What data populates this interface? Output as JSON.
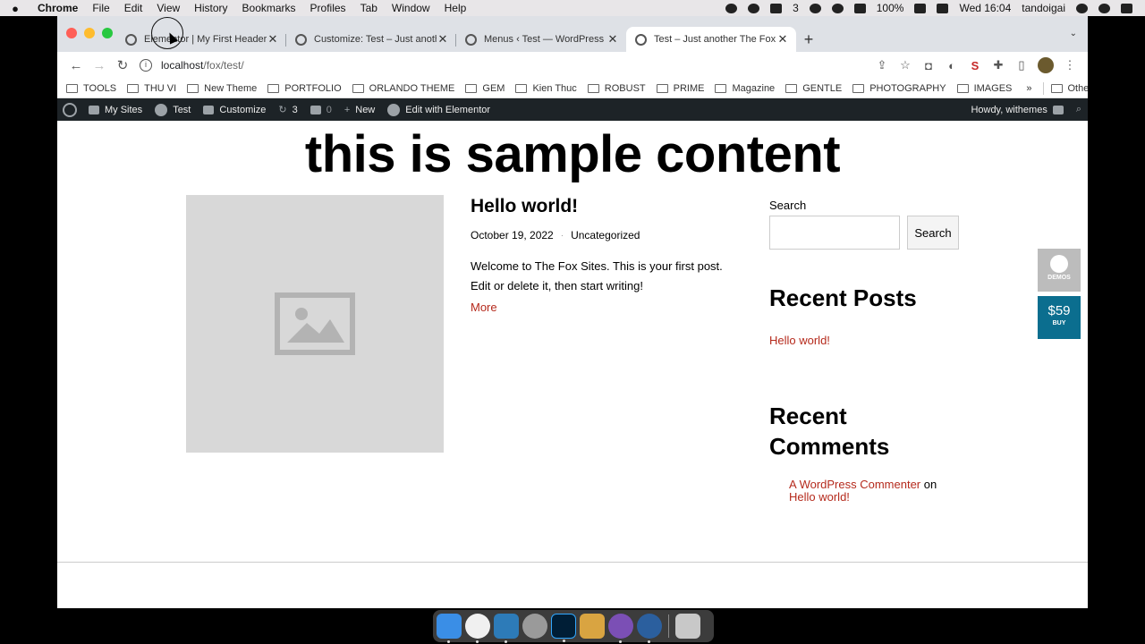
{
  "menubar": {
    "app": "Chrome",
    "items": [
      "File",
      "Edit",
      "View",
      "History",
      "Bookmarks",
      "Profiles",
      "Tab",
      "Window",
      "Help"
    ],
    "status_badge": "3",
    "battery": "100%",
    "datetime": "Wed 16:04",
    "user": "tandoigai"
  },
  "tabs": [
    {
      "title": "Elementor | My First Header",
      "active": false
    },
    {
      "title": "Customize: Test – Just another",
      "active": false
    },
    {
      "title": "Menus ‹ Test — WordPress",
      "active": false
    },
    {
      "title": "Test – Just another The Fox Si",
      "active": true
    }
  ],
  "omnibox": {
    "host": "localhost",
    "path": "/fox/test/"
  },
  "bookmarks": [
    "TOOLS",
    "THU VI",
    "New Theme",
    "PORTFOLIO",
    "ORLANDO THEME",
    "GEM",
    "Kien Thuc",
    "ROBUST",
    "PRIME",
    "Magazine",
    "GENTLE",
    "PHOTOGRAPHY",
    "IMAGES"
  ],
  "bookmarks_more": "»",
  "other_bookmarks": "Other Bookmarks",
  "wpbar": {
    "my_sites": "My Sites",
    "site": "Test",
    "customize": "Customize",
    "updates": "3",
    "comments": "0",
    "new": "New",
    "elementor": "Edit with Elementor",
    "howdy": "Howdy, withemes"
  },
  "page": {
    "headline": "this is sample content",
    "post": {
      "title": "Hello world!",
      "date": "October 19, 2022",
      "category": "Uncategorized",
      "excerpt": "Welcome to The Fox Sites. This is your first post. Edit or delete it, then start writing!",
      "more": "More"
    },
    "sidebar": {
      "search_label": "Search",
      "search_button": "Search",
      "search_placeholder": "",
      "recent_posts_title": "Recent Posts",
      "recent_posts": [
        "Hello world!"
      ],
      "recent_comments_title": "Recent Comments",
      "comment_author": "A WordPress Commenter",
      "comment_on": "on",
      "comment_post": "Hello world!"
    },
    "float": {
      "demos": "DEMOS",
      "price": "$59",
      "buy": "BUY"
    }
  },
  "colors": {
    "link": "#b52a1c",
    "wpbar": "#1d2327",
    "buy": "#0b6e8f"
  }
}
